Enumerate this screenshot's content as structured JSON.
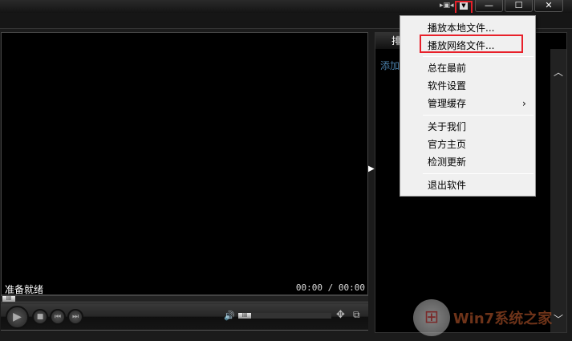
{
  "titlebar": {
    "mini_mode_icon": "mini-mode-icon",
    "menu_icon": "dropdown-menu-icon",
    "minimize": "—",
    "maximize": "☐",
    "close": "✕"
  },
  "player": {
    "status": "准备就绪",
    "time": "00:00 / 00:00"
  },
  "playlist": {
    "tab": "排",
    "add_hint": "添加"
  },
  "menu": {
    "items": [
      "播放本地文件...",
      "播放网络文件...",
      "总在最前",
      "软件设置",
      "管理缓存",
      "关于我们",
      "官方主页",
      "检测更新",
      "退出软件"
    ],
    "submenu_arrow": "›"
  },
  "watermark": {
    "text": "Win7系统之家"
  }
}
